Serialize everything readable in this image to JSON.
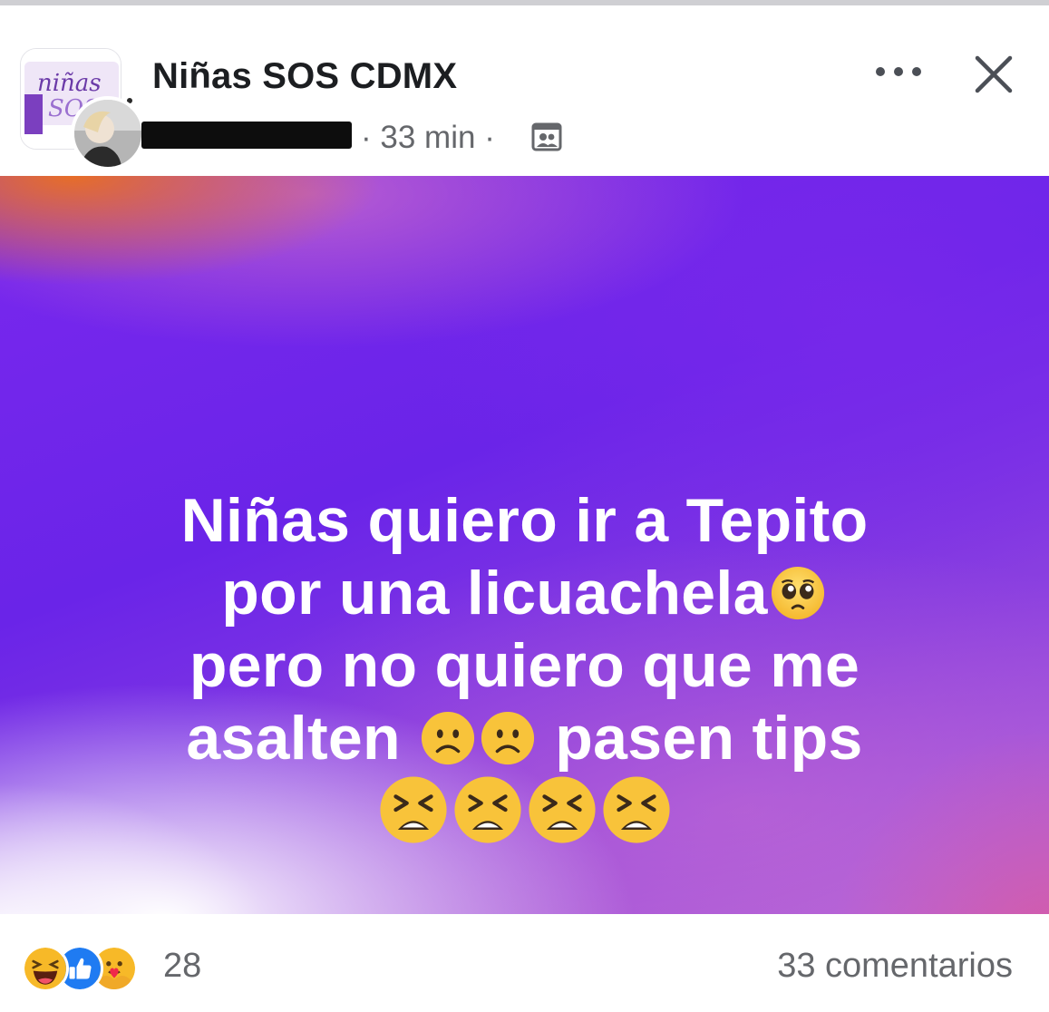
{
  "header": {
    "group_name": "Niñas SOS CDMX",
    "group_logo_text": "niñas SOS",
    "time": "33 min",
    "separator": "·"
  },
  "icons": {
    "more": "more-horizontal-icon",
    "close": "close-icon",
    "audience": "group-audience-icon"
  },
  "post": {
    "lines": [
      "Niñas quiero ir a Tepito",
      "por una licuachela",
      "pero no quiero que me",
      "asalten",
      "pasen tips"
    ],
    "emojis": {
      "line2": "pleading-face",
      "line4": [
        "frowning-face",
        "frowning-face"
      ],
      "line5": [
        "tired-face",
        "tired-face",
        "tired-face",
        "tired-face"
      ]
    },
    "colors": {
      "text": "#ffffff",
      "background_main": "#7a28ee"
    }
  },
  "footer": {
    "reaction_types": [
      "haha",
      "like",
      "care"
    ],
    "reaction_count": "28",
    "comments": "33 comentarios"
  }
}
